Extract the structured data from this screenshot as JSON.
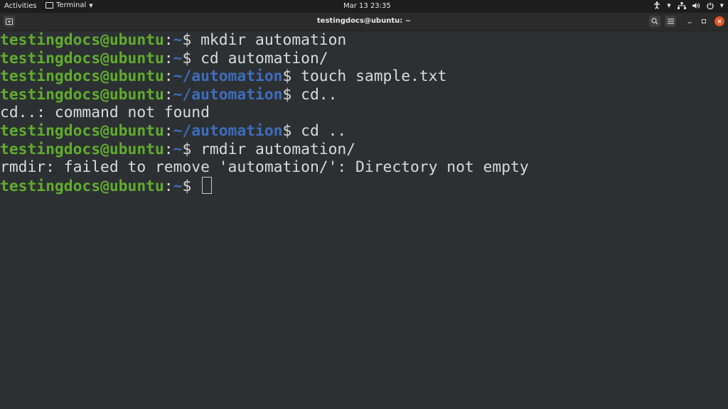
{
  "topbar": {
    "activities": "Activities",
    "app_name": "Terminal",
    "clock": "Mar 13  23:35",
    "tray_icons": [
      "accessibility-icon",
      "network-icon",
      "volume-icon",
      "power-icon"
    ]
  },
  "window": {
    "title": "testingdocs@ubuntu: ~"
  },
  "terminal": {
    "user_host": "testingdocs@ubuntu",
    "lines": [
      {
        "type": "prompt",
        "path": "~",
        "cmd": " mkdir automation"
      },
      {
        "type": "prompt",
        "path": "~",
        "cmd": " cd automation/"
      },
      {
        "type": "prompt",
        "path": "~/automation",
        "cmd": " touch sample.txt"
      },
      {
        "type": "prompt",
        "path": "~/automation",
        "cmd": " cd.."
      },
      {
        "type": "output",
        "text": "cd..: command not found"
      },
      {
        "type": "prompt",
        "path": "~/automation",
        "cmd": " cd .."
      },
      {
        "type": "prompt",
        "path": "~",
        "cmd": " rmdir automation/"
      },
      {
        "type": "output",
        "text": "rmdir: failed to remove 'automation/': Directory not empty"
      },
      {
        "type": "prompt",
        "path": "~",
        "cmd": " ",
        "cursor": true
      }
    ]
  },
  "colors": {
    "user": "#5fac2e",
    "path": "#3d6dbd",
    "text": "#dadada",
    "background": "#2d3032",
    "close_button": "#e95420"
  }
}
